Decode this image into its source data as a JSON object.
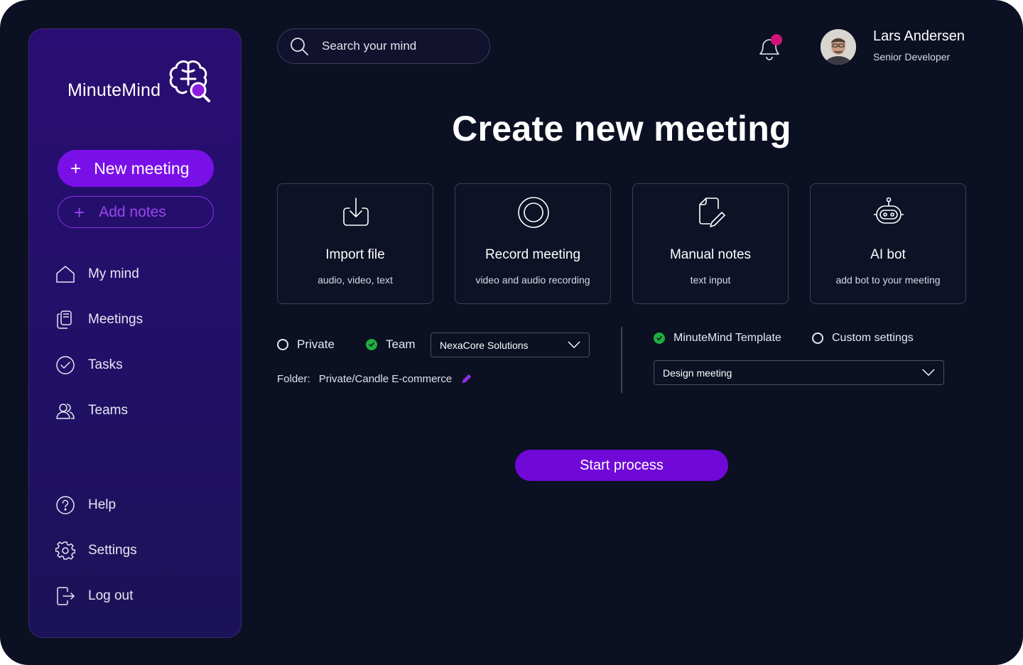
{
  "app": {
    "name": "MinuteMind"
  },
  "sidebar": {
    "new_meeting_label": "New meeting",
    "add_notes_label": "Add notes",
    "nav": [
      {
        "label": "My mind",
        "icon": "home-icon"
      },
      {
        "label": "Meetings",
        "icon": "documents-icon"
      },
      {
        "label": "Tasks",
        "icon": "check-circle-icon"
      },
      {
        "label": "Teams",
        "icon": "users-icon"
      }
    ],
    "footer": [
      {
        "label": "Help",
        "icon": "help-icon"
      },
      {
        "label": "Settings",
        "icon": "gear-icon"
      },
      {
        "label": "Log out",
        "icon": "logout-icon"
      }
    ]
  },
  "header": {
    "search_placeholder": "Search your mind",
    "user": {
      "name": "Lars Andersen",
      "role": "Senior Developer"
    },
    "notification_badge_color": "#d4137a"
  },
  "main": {
    "title": "Create new meeting",
    "cards": [
      {
        "title": "Import file",
        "subtitle": "audio, video, text",
        "icon": "download-icon"
      },
      {
        "title": "Record meeting",
        "subtitle": "video and audio recording",
        "icon": "record-icon"
      },
      {
        "title": "Manual notes",
        "subtitle": "text input",
        "icon": "edit-document-icon"
      },
      {
        "title": "AI bot",
        "subtitle": "add bot to your meeting",
        "icon": "robot-icon"
      }
    ],
    "visibility": {
      "private_label": "Private",
      "team_label": "Team",
      "selected": "Team",
      "team_select_value": "NexaCore Solutions"
    },
    "folder": {
      "label": "Folder:",
      "path": "Private/Candle E-commerce"
    },
    "template": {
      "minutemind_label": "MinuteMind Template",
      "custom_label": "Custom settings",
      "selected": "MinuteMind Template",
      "template_select_value": "Design meeting"
    },
    "start_button_label": "Start process"
  },
  "colors": {
    "background": "#0b1022",
    "sidebar": "#22106a",
    "accent": "#7a10e8",
    "check_green": "#1fae3e"
  }
}
